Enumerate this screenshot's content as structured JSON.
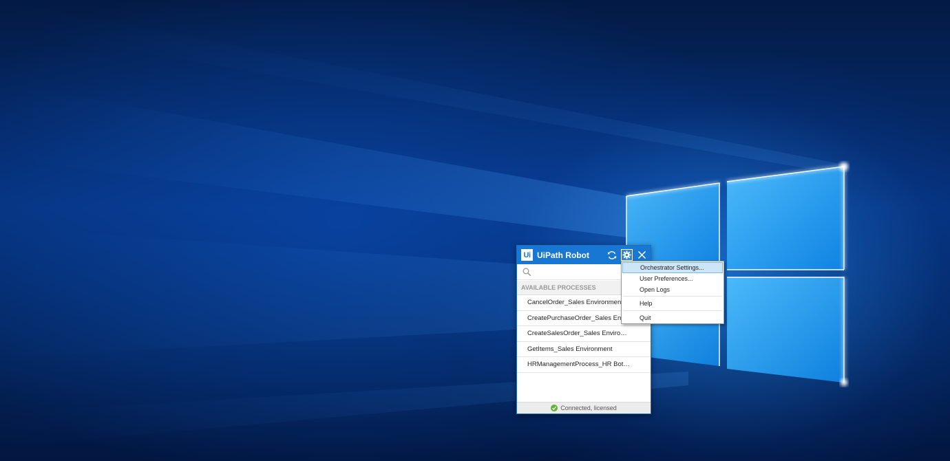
{
  "robot": {
    "logo_text": "Ui",
    "title": "UiPath Robot",
    "icons": {
      "refresh": "refresh-icon",
      "settings": "gear-icon",
      "close": "close-icon",
      "search": "search-icon",
      "status": "check-circle-icon"
    },
    "search": {
      "value": "",
      "placeholder": ""
    },
    "section_header": "AVAILABLE PROCESSES",
    "processes": [
      "CancelOrder_Sales Environment",
      "CreatePurchaseOrder_Sales Envir...",
      "CreateSalesOrder_Sales Environm...",
      "GetItems_Sales Environment",
      "HRManagementProcess_HR Bot E..."
    ],
    "status": "Connected, licensed",
    "colors": {
      "accent": "#1777d3",
      "status_ok": "#5fb336"
    }
  },
  "settings_menu": {
    "items": [
      "Orchestrator Settings...",
      "User Preferences...",
      "Open Logs",
      "Help",
      "Quit"
    ],
    "highlighted_index": 0,
    "highlight_color": "#cde6f7"
  }
}
